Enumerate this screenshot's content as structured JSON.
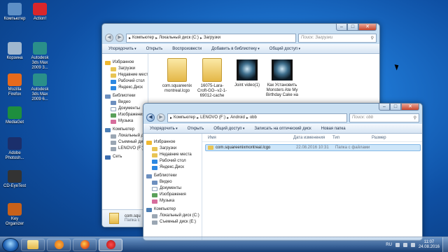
{
  "desktop_icons": [
    {
      "label": "Компьютер",
      "icon": "computer-icon",
      "color": "#5d8fc6"
    },
    {
      "label": "Action!",
      "icon": "action-app-icon",
      "color": "#d9262b"
    },
    {
      "label": "Корзина",
      "icon": "recycle-bin-icon",
      "color": "#9fb7cf"
    },
    {
      "label": "Autodesk 3ds Max 2009 3...",
      "icon": "3ds-max-icon",
      "color": "#2a8f8a"
    },
    {
      "label": "Mozilla Firefox",
      "icon": "firefox-icon",
      "color": "#e66a1c"
    },
    {
      "label": "Autodesk 3ds Max 2009 6...",
      "icon": "3ds-max-icon",
      "color": "#2a8f8a"
    },
    {
      "label": "MediaGet",
      "icon": "mediaget-icon",
      "color": "#1e8e3e"
    },
    {
      "label": "Adobe Photosh...",
      "icon": "photoshop-icon",
      "color": "#1b2f6b"
    },
    {
      "label": "CD-EyeTest",
      "icon": "webcam-icon",
      "color": "#333333"
    },
    {
      "label": "Key Organizer",
      "icon": "key-organizer-icon",
      "color": "#c8611a"
    }
  ],
  "back_window": {
    "address_parts": [
      "Компьютер",
      "Локальный диск (C:)",
      "Загрузки"
    ],
    "search_placeholder": "Поиск: Загрузки",
    "commands": [
      "Упорядочить",
      "Открыть",
      "Воспроизвести",
      "Добавить в библиотеку",
      "Общий доступ"
    ],
    "nav": {
      "favorites": "Избранное",
      "favorites_items": [
        "Загрузки",
        "Недавние места",
        "Рабочий стол",
        "Яндекс.Диск"
      ],
      "libraries": "Библиотеки",
      "libraries_items": [
        "Видео",
        "Документы",
        "Изображения",
        "Музыка"
      ],
      "computer": "Компьютер",
      "computer_items": [
        "Локальный диск (C:)",
        "Съемный диск (E:)",
        "LENOVO (F:)"
      ],
      "network": "Сеть"
    },
    "files": [
      {
        "name": "com.squareenix montreal.lcgo",
        "kind": "folder"
      },
      {
        "name": "16075-Lara-Croft-GO--v2-1-69012-cache",
        "kind": "folder"
      },
      {
        "name": "Joint video(1)",
        "kind": "video"
      },
      {
        "name": "Как Установить Monsters Ate My Birthday Cake на",
        "kind": "video"
      }
    ],
    "status_name": "com.squ",
    "status_type": "Папка с"
  },
  "front_window": {
    "address_parts": [
      "Компьютер",
      "LENOVO (F:)",
      "Android",
      "obb"
    ],
    "search_placeholder": "Поиск: obb",
    "commands": [
      "Упорядочить",
      "Открыть",
      "Общий доступ",
      "Записать на оптический диск",
      "Новая папка"
    ],
    "columns": [
      "Имя",
      "Дата изменения",
      "Тип",
      "Размер"
    ],
    "rows": [
      {
        "name": "com.squareenixmontreal.lcgo",
        "date": "22.08.2016 10:31",
        "type": "Папка с файлами",
        "size": ""
      }
    ],
    "nav": {
      "favorites": "Избранное",
      "favorites_items": [
        "Загрузки",
        "Недавние места",
        "Рабочий стол",
        "Яндекс.Диск"
      ],
      "libraries": "Библиотеки",
      "libraries_items": [
        "Видео",
        "Документы",
        "Изображения",
        "Музыка"
      ],
      "computer": "Компьютер",
      "computer_items": [
        "Локальный диск (C:)",
        "Съемный диск (E:)"
      ]
    }
  },
  "taskbar": {
    "items": [
      "windows-explorer",
      "media-player",
      "firefox",
      "action-app"
    ],
    "language": "RU",
    "time": "11:07",
    "date": "24.08.2016"
  }
}
